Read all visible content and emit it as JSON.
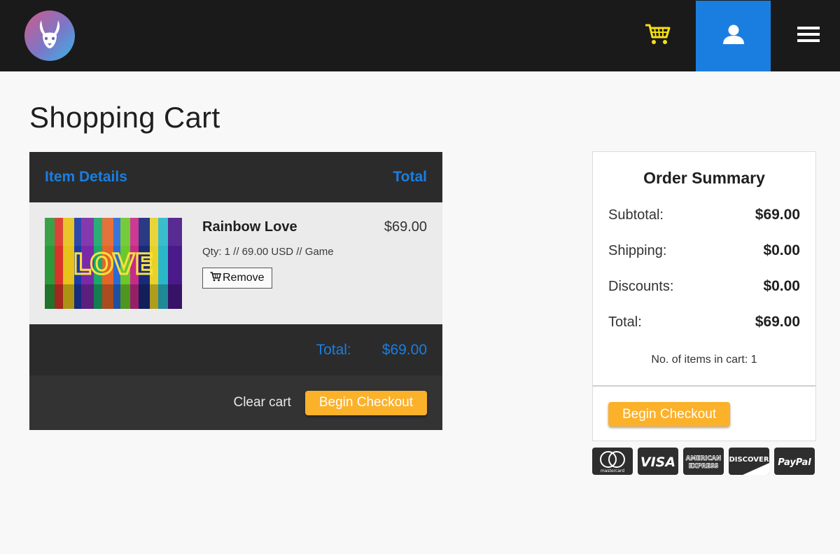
{
  "header": {
    "logo": "rabbit-logo",
    "cart_icon": "shopping-cart-icon",
    "user_icon": "user-icon",
    "menu_icon": "hamburger-menu-icon",
    "accent": "#1a7ee0",
    "cart_icon_color": "#f6e012"
  },
  "page": {
    "title": "Shopping Cart"
  },
  "cart": {
    "headers": {
      "item": "Item Details",
      "total": "Total"
    },
    "items": [
      {
        "name": "Rainbow Love",
        "price": "$69.00",
        "meta": "Qty: 1 // 69.00 USD // Game",
        "remove_label": "Remove",
        "thumbnail_text": "LOVE"
      }
    ],
    "total_label": "Total:",
    "total_value": "$69.00",
    "clear_label": "Clear cart",
    "checkout_label": "Begin Checkout"
  },
  "summary": {
    "title": "Order Summary",
    "rows": [
      {
        "label": "Subtotal:",
        "value": "$69.00"
      },
      {
        "label": "Shipping:",
        "value": "$0.00"
      },
      {
        "label": "Discounts:",
        "value": "$0.00"
      },
      {
        "label": "Total:",
        "value": "$69.00"
      }
    ],
    "items_count": "No. of items in cart: 1",
    "checkout_label": "Begin Checkout"
  },
  "payment_cards": {
    "mastercard_text": "mastercard",
    "visa_text": "VISA",
    "amex_line1": "AMERICAN",
    "amex_line2": "EXPRESS",
    "discover_text": "DISCOVER",
    "paypal_text": "PayPal"
  },
  "colors": {
    "checkout": "#fbb12a",
    "dark_panel": "#2b2b2b"
  }
}
